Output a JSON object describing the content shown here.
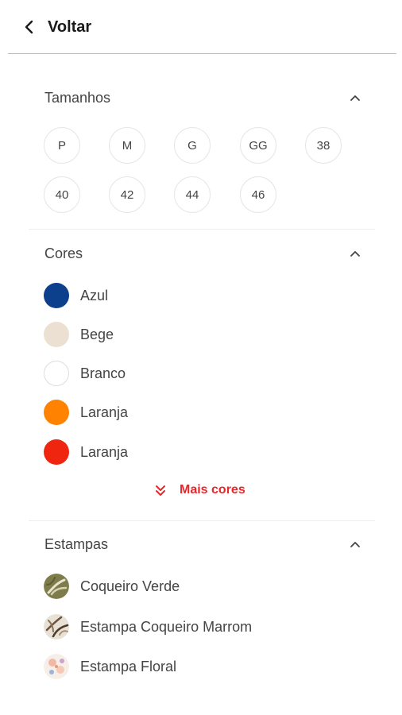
{
  "header": {
    "back_label": "Voltar"
  },
  "sizes": {
    "title": "Tamanhos",
    "options": [
      "P",
      "M",
      "G",
      "GG",
      "38",
      "40",
      "42",
      "44",
      "46"
    ]
  },
  "colors": {
    "title": "Cores",
    "options": [
      {
        "label": "Azul",
        "swatch": "#0c3f8c"
      },
      {
        "label": "Bege",
        "swatch": "#ebe0d2"
      },
      {
        "label": "Branco",
        "swatch": "#ffffff"
      },
      {
        "label": "Laranja",
        "swatch": "#ff8200"
      },
      {
        "label": "Laranja",
        "swatch": "#f0250f"
      }
    ],
    "more_label": "Mais cores",
    "accent": "#e8272b"
  },
  "prints": {
    "title": "Estampas",
    "options": [
      {
        "label": "Coqueiro Verde",
        "icon": "coqueiro-verde-print-icon"
      },
      {
        "label": "Estampa Coqueiro Marrom",
        "icon": "coqueiro-marrom-print-icon"
      },
      {
        "label": "Estampa Floral",
        "icon": "floral-print-icon"
      }
    ]
  }
}
